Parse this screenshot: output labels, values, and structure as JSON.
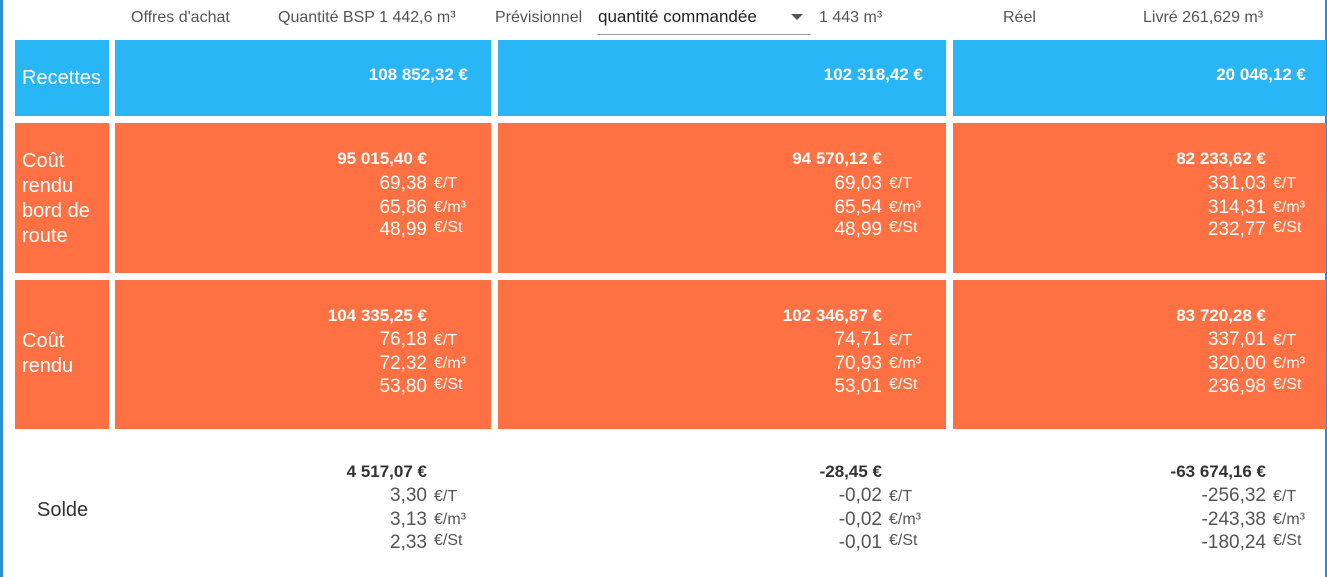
{
  "header": {
    "offres": "Offres d'achat",
    "quantite_bsp": "Quantité BSP 1 442,6 m³",
    "previsionnel": "Prévisionnel",
    "select_value": "quantité commandée",
    "prev_quantite": "1 443 m³",
    "reel": "Réel",
    "livre": "Livré 261,629 m³"
  },
  "colors": {
    "recettes": "#29b6f6",
    "cout": "#ff7043"
  },
  "units": {
    "t": "€/T",
    "m3": "€/m³",
    "st": "€/St"
  },
  "rows": {
    "recettes": {
      "label": "Recettes",
      "values": [
        "108 852,32 €",
        "102 318,42 €",
        "20 046,12 €"
      ]
    },
    "crbr": {
      "label_lines": [
        "Coût",
        "rendu",
        "bord de",
        "route"
      ],
      "cols": [
        {
          "main": "95 015,40 €",
          "t": "69,38",
          "m3": "65,86",
          "st": "48,99"
        },
        {
          "main": "94 570,12 €",
          "t": "69,03",
          "m3": "65,54",
          "st": "48,99"
        },
        {
          "main": "82 233,62 €",
          "t": "331,03",
          "m3": "314,31",
          "st": "232,77"
        }
      ]
    },
    "cr": {
      "label_lines": [
        "Coût",
        "rendu"
      ],
      "cols": [
        {
          "main": "104 335,25 €",
          "t": "76,18",
          "m3": "72,32",
          "st": "53,80"
        },
        {
          "main": "102 346,87 €",
          "t": "74,71",
          "m3": "70,93",
          "st": "53,01"
        },
        {
          "main": "83 720,28 €",
          "t": "337,01",
          "m3": "320,00",
          "st": "236,98"
        }
      ]
    },
    "solde": {
      "label": "Solde",
      "cols": [
        {
          "main": "4 517,07 €",
          "t": "3,30",
          "m3": "3,13",
          "st": "2,33"
        },
        {
          "main": "-28,45 €",
          "t": "-0,02",
          "m3": "-0,02",
          "st": "-0,01"
        },
        {
          "main": "-63 674,16 €",
          "t": "-256,32",
          "m3": "-243,38",
          "st": "-180,24"
        }
      ]
    }
  }
}
